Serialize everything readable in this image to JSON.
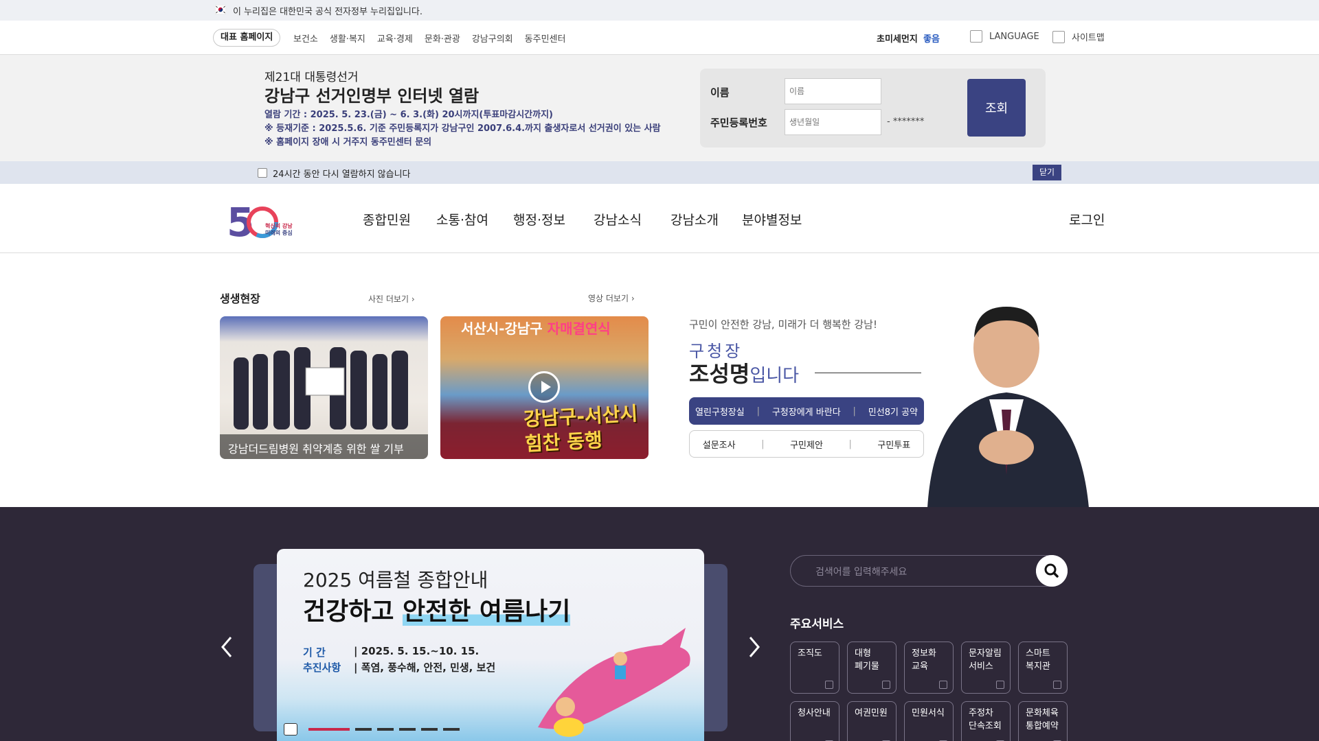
{
  "gov_banner": {
    "text": "이 누리집은 대한민국 공식 전자정부 누리집입니다."
  },
  "utility": {
    "main_home": "대표 홈페이지",
    "sites": [
      "보건소",
      "생활·복지",
      "교육·경제",
      "문화·관광",
      "강남구의회",
      "동주민센터"
    ],
    "fine_dust_label": "초미세먼지",
    "fine_dust_value": "좋음",
    "language": "LANGUAGE",
    "sitemap": "사이트맵"
  },
  "popup": {
    "subtitle": "제21대 대통령선거",
    "title": "강남구 선거인명부 인터넷 열람",
    "line1": "열람 기간 : 2025. 5. 23.(금) ~ 6. 3.(화) 20시까지(투표마감시간까지)",
    "line2": "※ 등재기준 : 2025.5.6. 기준 주민등록지가 강남구인 2007.6.4.까지 출생자로서 선거권이 있는 사람",
    "line3": "※ 홈페이지 장애 시 거주지 동주민센터 문의",
    "form": {
      "name_label": "이름",
      "name_placeholder": "이름",
      "rrn_label": "주민등록번호",
      "birth_placeholder": "생년월일",
      "mask": "- *******",
      "search_button": "조회"
    },
    "dont_show": "24시간 동안 다시 열람하지 않습니다",
    "close": "닫기"
  },
  "header": {
    "logo_text": "혁신의 강남 미래의 중심",
    "menu": [
      "종합민원",
      "소통·참여",
      "행정·정보",
      "강남소식",
      "강남소개",
      "분야별정보"
    ],
    "login": "로그인"
  },
  "live_scene": {
    "title": "생생현장",
    "more_photo": "사진 더보기",
    "more_video": "영상 더보기",
    "photo_caption": "강남더드림병원 취약계층 위한 쌀 기부",
    "video_headline_a": "서산시-강남구 ",
    "video_headline_b": "자매결연식",
    "video_tag": "강남구-서산시 힘찬 동행"
  },
  "mayor": {
    "intro": "구민이 안전한 강남, 미래가 더 행복한 강남!",
    "role": "구청장",
    "name": "조성명",
    "suffix": "입니다",
    "buttons_primary": [
      "열린구청장실",
      "구청장에게 바란다",
      "민선8기 공약"
    ],
    "buttons_secondary": [
      "설문조사",
      "구민제안",
      "구민투표"
    ]
  },
  "banner": {
    "line1": "2025 여름철 종합안내",
    "line2_a": "건강하고 ",
    "line2_b": "안전한 여름나기",
    "period_label": "기    간",
    "period_value": "| 2025. 5. 15.~10. 15.",
    "items_label": "추진사항",
    "items_value": "| 폭염, 풍수해, 안전, 민생, 보건"
  },
  "search": {
    "placeholder": "검색어를 입력해주세요"
  },
  "services": {
    "title": "주요서비스",
    "row1": [
      "조직도",
      "대형\n폐기물",
      "정보화\n교육",
      "문자알림\n서비스",
      "스마트\n복지관"
    ],
    "row2": [
      "청사안내",
      "여권민원",
      "민원서식",
      "주정차\n단속조회",
      "문화체육\n통합예약"
    ]
  },
  "colors": {
    "navy": "#3a4382",
    "dark_bg": "#2e2838",
    "accent_red": "#c8284a"
  }
}
